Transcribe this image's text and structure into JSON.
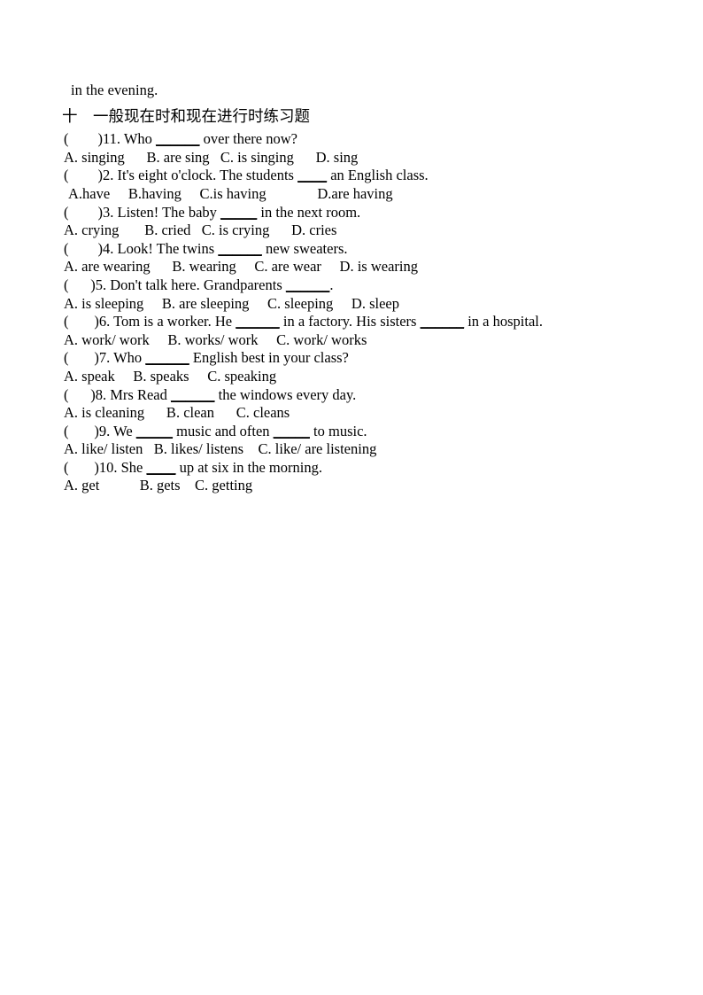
{
  "document": {
    "carryover_text": "in the evening.",
    "section_heading": "十　一般现在时和现在进行时练习题",
    "questions": [
      {
        "marker": "(        )",
        "number": "11.",
        "stem_before": " Who ",
        "blank": "______",
        "stem_after": " over there now?",
        "options_line": "A. singing      B. are sing   C. is singing      D. sing",
        "options_indent": false
      },
      {
        "marker": "(        )",
        "number": "2.",
        "stem_before": " It's eight o'clock. The students ",
        "blank": "____",
        "stem_after": " an English class.",
        "options_line": "A.have     B.having     C.is having              D.are having",
        "options_indent": true
      },
      {
        "marker": "(        )",
        "number": "3.",
        "stem_before": " Listen! The baby ",
        "blank": "_____",
        "stem_after": " in the next room.",
        "options_line": "A. crying       B. cried   C. is crying      D. cries",
        "options_indent": false
      },
      {
        "marker": "(        )",
        "number": "4.",
        "stem_before": " Look! The twins ",
        "blank": "______",
        "stem_after": " new sweaters.",
        "options_line": "A. are wearing      B. wearing     C. are wear     D. is wearing",
        "options_indent": false
      },
      {
        "marker": "(      )",
        "number": "5.",
        "stem_before": " Don't talk here. Grandparents ",
        "blank": "______",
        "stem_after": ".",
        "options_line": "A. is sleeping     B. are sleeping     C. sleeping     D. sleep",
        "options_indent": false
      },
      {
        "marker": "(       )",
        "number": "6.",
        "stem_before": " Tom is a worker. He ",
        "blank": "______",
        "stem_after": " in a factory. His sisters ",
        "blank2": "______",
        "stem_after2": " in a hospital.",
        "options_line": "A. work/ work     B. works/ work     C. work/ works",
        "options_indent": false
      },
      {
        "marker": "(       )",
        "number": "7.",
        "stem_before": " Who ",
        "blank": "______",
        "stem_after": " English best in your class?",
        "options_line": "A. speak     B. speaks     C. speaking",
        "options_indent": false
      },
      {
        "marker": "(      )",
        "number": "8.",
        "stem_before": " Mrs Read ",
        "blank": "______",
        "stem_after": " the windows every day.",
        "options_line": "A. is cleaning      B. clean      C. cleans",
        "options_indent": false
      },
      {
        "marker": "(       )",
        "number": "9.",
        "stem_before": " We ",
        "blank": "_____",
        "stem_after": " music and often ",
        "blank2": "_____",
        "stem_after2": " to music.",
        "options_line": "A. like/ listen   B. likes/ listens    C. like/ are listening",
        "options_indent": false
      },
      {
        "marker": "(       )",
        "number": "10.",
        "stem_before": " She ",
        "blank": "____",
        "stem_after": " up at six in the morning.",
        "options_line": "A. get           B. gets    C. getting",
        "options_indent": false
      }
    ]
  }
}
